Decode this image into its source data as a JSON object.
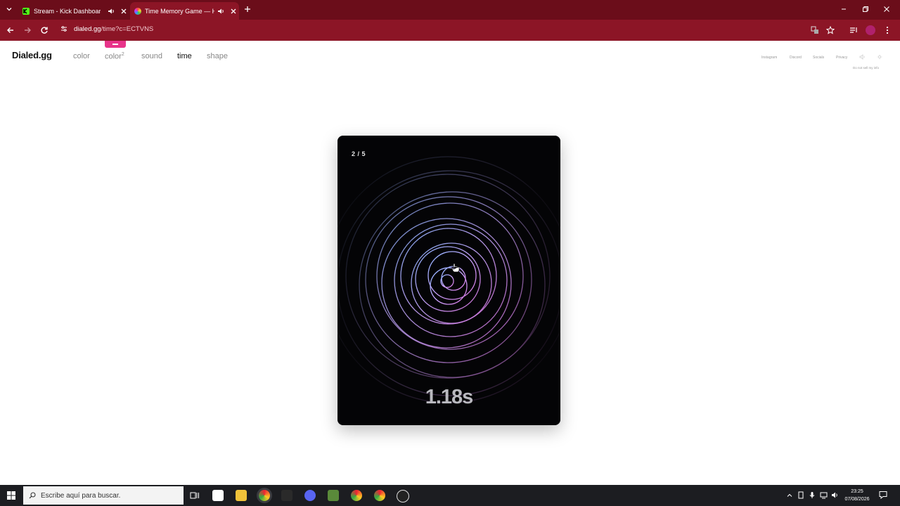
{
  "browser": {
    "tabs": [
      {
        "title": "Stream - Kick Dashboard",
        "active": false
      },
      {
        "title": "Time Memory Game — Ho",
        "active": true
      }
    ],
    "url": {
      "host": "dialed.gg",
      "path": "/time?c=ECTVNS"
    }
  },
  "site": {
    "logo": "Dialed.gg",
    "nav": [
      "color",
      "color",
      "sound",
      "time",
      "shape"
    ],
    "nav_superscript": "2",
    "active_nav": "time",
    "top_links": [
      "Instagram",
      "Discord",
      "Socials",
      "Privacy"
    ],
    "footer_link": "Do not sell my info"
  },
  "game": {
    "round": "2 / 5",
    "timer": "1.18s"
  },
  "taskbar": {
    "search_placeholder": "Escribe aquí para buscar.",
    "time": "23:25",
    "date": "07/08/2026"
  },
  "colors": {
    "tab_bar": "#6b0d1a",
    "toolbar": "#8c1526",
    "badge": "#e8348a",
    "card_bg": "#040406"
  }
}
